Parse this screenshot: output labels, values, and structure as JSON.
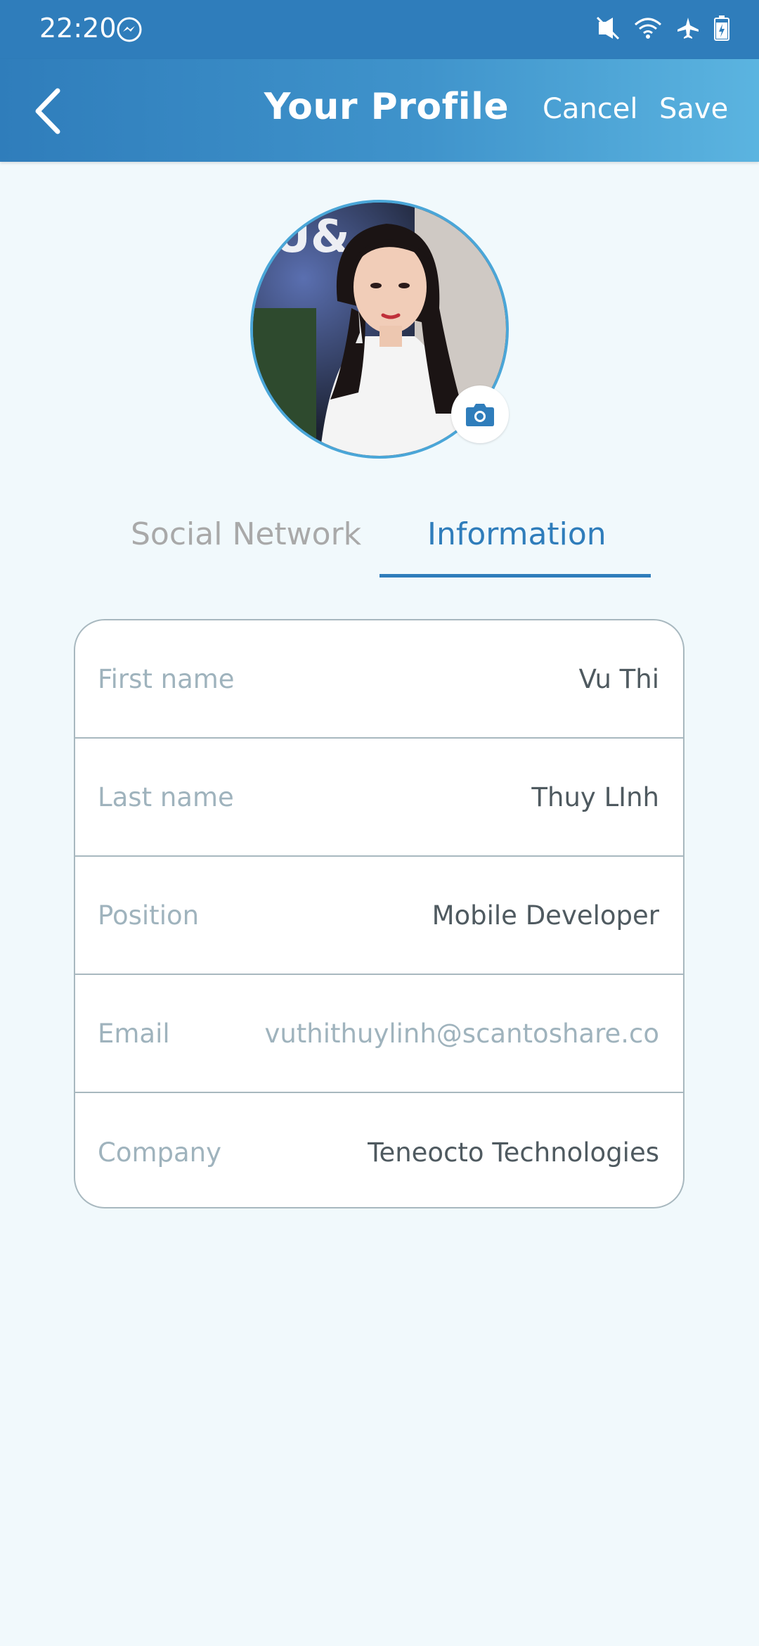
{
  "status_bar": {
    "time": "22:20",
    "icons": [
      "messenger-icon",
      "mute-vibrate-icon",
      "wifi-icon",
      "airplane-icon",
      "battery-charging-icon"
    ]
  },
  "header": {
    "title": "Your Profile",
    "cancel_label": "Cancel",
    "save_label": "Save",
    "back_icon": "chevron-left-icon"
  },
  "avatar": {
    "camera_icon": "camera-icon",
    "ring_color": "#4aa6d8"
  },
  "tabs": [
    {
      "label": "Social Network",
      "active": false
    },
    {
      "label": "Information",
      "active": true
    }
  ],
  "info": {
    "rows": [
      {
        "label": "First name",
        "value": "Vu Thi"
      },
      {
        "label": "Last name",
        "value": "Thuy LInh"
      },
      {
        "label": "Position",
        "value": "Mobile Developer"
      },
      {
        "label": "Email",
        "value": "vuthithuylinh@scantoshare.co"
      },
      {
        "label": "Company",
        "value": "Teneocto Technologies"
      }
    ]
  },
  "colors": {
    "primary": "#2f7dbb",
    "header_gradient_end": "#5bb4e0",
    "background": "#f1f9fc",
    "label_text": "#9fb3bd",
    "value_text": "#4f5a60"
  }
}
